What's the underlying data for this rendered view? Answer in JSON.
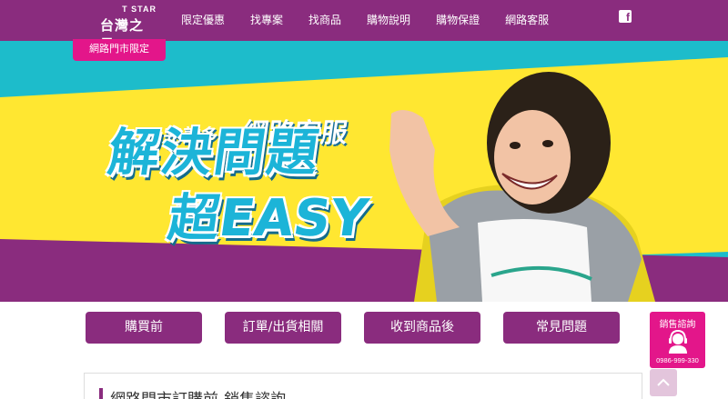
{
  "brand": {
    "name_en": "T STAR",
    "name_zh": "台灣之星"
  },
  "nav": {
    "items": [
      "限定優惠",
      "找專案",
      "找商品",
      "購物說明",
      "購物保證",
      "網路客服"
    ]
  },
  "social": {
    "icon": "facebook-icon",
    "glyph": "f"
  },
  "tag": {
    "label": "網路門市限定"
  },
  "hero": {
    "sub_a": "完善多元",
    "sub_b": "網路客服",
    "title_line1": "解決問題",
    "title_line2": "超EASY"
  },
  "categories": [
    "購買前",
    "訂單/出貨相關",
    "收到商品後",
    "常見問題"
  ],
  "consult": {
    "label": "銷售諮詢",
    "phone": "0986-999-330",
    "icon": "headset-agent-icon"
  },
  "scroll_top": {
    "icon": "chevron-up-icon"
  },
  "section": {
    "title": "網路門市訂購前-銷售諮詢"
  },
  "colors": {
    "brand_purple": "#8a2c7e",
    "accent_pink": "#e3168a",
    "hero_cyan": "#1dbccb",
    "hero_yellow": "#ffe731",
    "title_blue": "#1cb4d8"
  }
}
